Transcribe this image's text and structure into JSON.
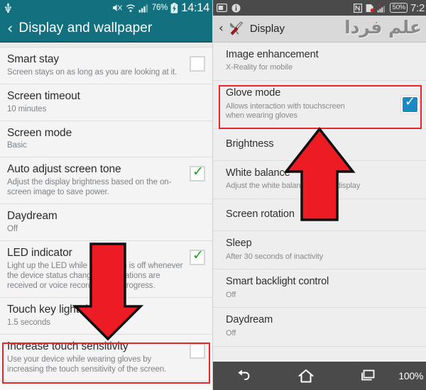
{
  "left_screen": {
    "platform_name": "samsung-display-settings",
    "accent_color": "#13707e",
    "status_bar": {
      "icons": [
        "usb-icon",
        "mute-icon",
        "wifi-icon",
        "signal-icon"
      ],
      "battery_percent": "76%",
      "battery_icon": "battery-charging-icon",
      "clock": "14:14"
    },
    "app_bar": {
      "back_icon": "back-chevron-icon",
      "title": "Display and wallpaper"
    },
    "rows": [
      {
        "title": "Smart stay",
        "subtitle": "Screen stays on as long as you are looking at it.",
        "control": "checkbox",
        "checked": false
      },
      {
        "title": "Screen timeout",
        "subtitle": "10 minutes",
        "control": "none",
        "checked": false
      },
      {
        "title": "Screen mode",
        "subtitle": "Basic",
        "control": "none",
        "checked": false
      },
      {
        "title": "Auto adjust screen tone",
        "subtitle": "Adjust the display brightness based on the on-screen image to save power.",
        "control": "checkbox",
        "checked": true
      },
      {
        "title": "Daydream",
        "subtitle": "Off",
        "control": "none",
        "checked": false
      },
      {
        "title": "LED indicator",
        "subtitle": "Light up the LED while the screen is off whenever the device status changes, notifications are received or voice recording is in progress.",
        "control": "checkbox",
        "checked": true
      },
      {
        "title": "Touch key light duration",
        "subtitle": "1.5 seconds",
        "control": "none",
        "checked": false
      },
      {
        "title": "Increase touch sensitivity",
        "subtitle": "Use your device while wearing gloves by increasing the touch sensitivity of the screen.",
        "control": "checkbox",
        "checked": false
      }
    ],
    "highlight": {
      "target_row_title": "Increase touch sensitivity",
      "color": "#e8262a"
    }
  },
  "right_screen": {
    "platform_name": "sony-display-settings",
    "accent_color": "#1b8ac4",
    "status_bar": {
      "icons": [
        "sim-card-icon",
        "info-icon",
        "nfc-icon",
        "sync-error-icon",
        "signal-icon"
      ],
      "battery_percent": "50%",
      "clock": "7:2"
    },
    "app_bar": {
      "back_icon": "back-chevron-icon",
      "app_icon": "wrench-screwdriver-icon",
      "title": "Display",
      "watermark": "علم فردا"
    },
    "rows": [
      {
        "title": "Image enhancement",
        "subtitle": "X-Reality for mobile",
        "control": "none",
        "checked": false
      },
      {
        "title": "Glove mode",
        "subtitle": "Allows interaction with touchscreen when wearing gloves",
        "control": "checkbox",
        "checked": true
      },
      {
        "title": "Brightness",
        "subtitle": "",
        "control": "none",
        "checked": false
      },
      {
        "title": "White balance",
        "subtitle": "Adjust the white balance of your display",
        "control": "none",
        "checked": false
      },
      {
        "title": "Screen rotation",
        "subtitle": "",
        "control": "none",
        "checked": false
      },
      {
        "title": "Sleep",
        "subtitle": "After 30 seconds of inactivity",
        "control": "none",
        "checked": false
      },
      {
        "title": "Smart backlight control",
        "subtitle": "Off",
        "control": "none",
        "checked": false
      },
      {
        "title": "Daydream",
        "subtitle": "Off",
        "control": "none",
        "checked": false
      }
    ],
    "highlight": {
      "target_row_title": "Glove mode",
      "color": "#e8262a"
    },
    "nav_bar": {
      "back_icon": "nav-back-icon",
      "home_icon": "nav-home-icon",
      "recents_icon": "nav-recents-icon",
      "battery_label": "100%"
    }
  },
  "annotations": {
    "color": "#ed1c24",
    "outline": "#111111",
    "arrows": [
      {
        "name": "down-arrow-left-panel",
        "direction": "down",
        "points_to": "Increase touch sensitivity"
      },
      {
        "name": "up-arrow-right-panel",
        "direction": "up",
        "points_to": "Glove mode"
      }
    ]
  }
}
